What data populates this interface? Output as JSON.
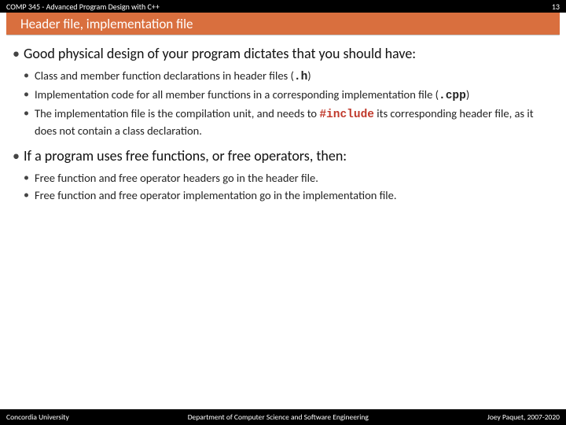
{
  "header": {
    "course": "COMP 345 - Advanced Program Design with C++",
    "slide_number": "13",
    "subtitle": "Header file, implementation file"
  },
  "content": {
    "b1": {
      "text": "Good physical design of your program dictates that you should have:",
      "sub": [
        {
          "pre": "Class and member function declarations in header files (",
          "code": ".h",
          "post": ")"
        },
        {
          "pre": "Implementation code for all member functions in a corresponding implementation file (",
          "code": ".cpp",
          "post": ")"
        },
        {
          "pre": "The implementation file is the compilation unit, and needs to ",
          "code": "#include",
          "post": " its corresponding header file, as it does not contain a class declaration.",
          "code_red": true
        }
      ]
    },
    "b2": {
      "text": "If a program uses free functions, or free operators, then:",
      "sub": [
        {
          "pre": "Free function and free operator headers go in the header file."
        },
        {
          "pre": "Free function and free operator implementation go in the implementation file."
        }
      ]
    }
  },
  "footer": {
    "left": "Concordia University",
    "center": "Department of Computer Science and Software Engineering",
    "right": "Joey Paquet, 2007-2020"
  }
}
